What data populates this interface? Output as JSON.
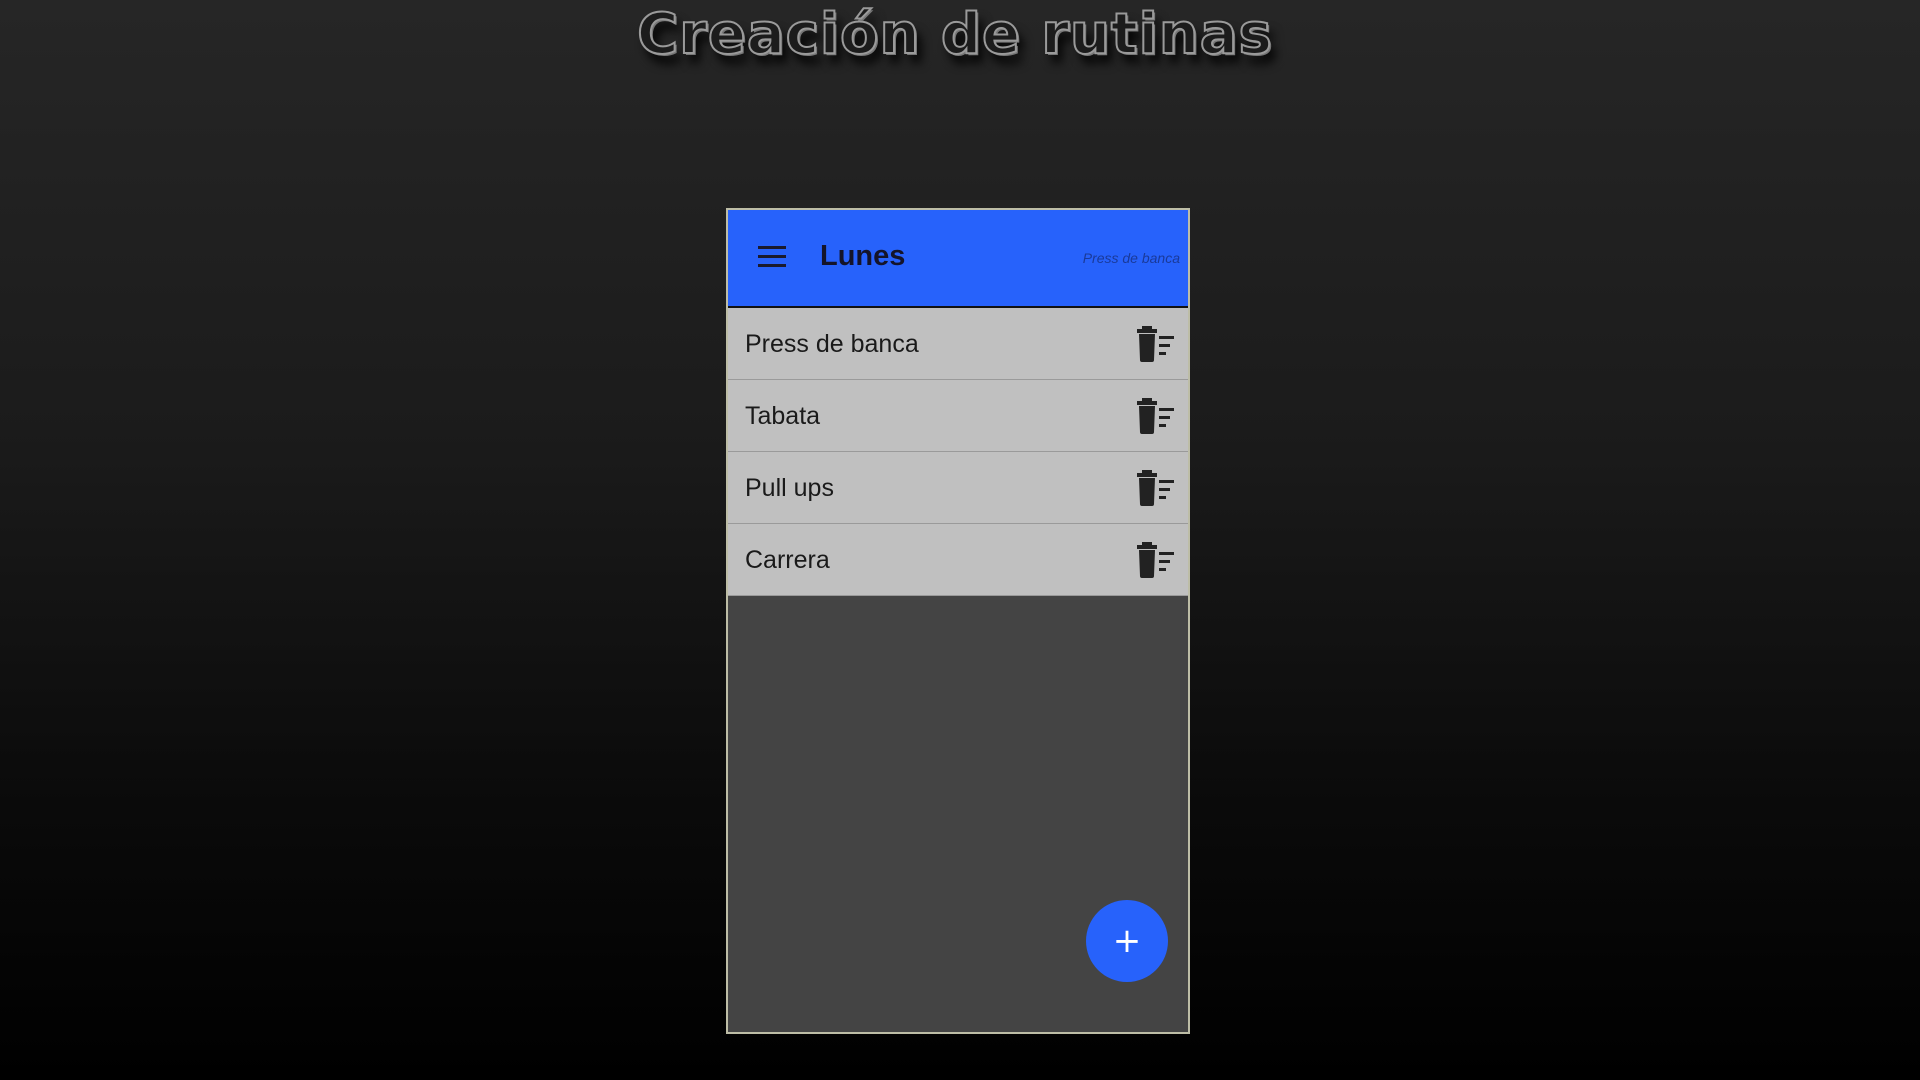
{
  "slide": {
    "title": "Creación de rutinas"
  },
  "app_bar": {
    "title": "Lunes",
    "subtitle": "Press de banca",
    "menu_icon": "hamburger-menu-icon"
  },
  "routines": [
    {
      "label": "Press de banca",
      "icon": "delete-sweep-icon"
    },
    {
      "label": "Tabata",
      "icon": "delete-sweep-icon"
    },
    {
      "label": "Pull ups",
      "icon": "delete-sweep-icon"
    },
    {
      "label": "Carrera",
      "icon": "delete-sweep-icon"
    }
  ],
  "fab": {
    "label": "+",
    "icon": "plus-icon"
  },
  "colors": {
    "primary": "#2762fb",
    "list_background": "#c0c0c0",
    "screen_background": "#444444"
  }
}
